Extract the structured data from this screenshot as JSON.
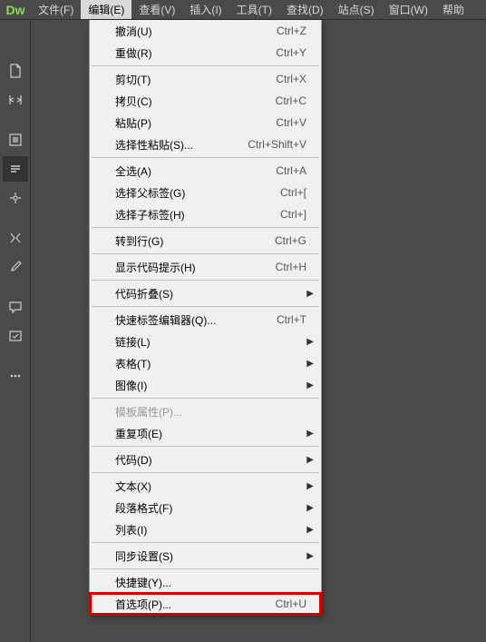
{
  "logo": "Dw",
  "menubar": [
    {
      "label": "文件(F)"
    },
    {
      "label": "编辑(E)",
      "active": true
    },
    {
      "label": "查看(V)"
    },
    {
      "label": "插入(I)"
    },
    {
      "label": "工具(T)"
    },
    {
      "label": "查找(D)"
    },
    {
      "label": "站点(S)"
    },
    {
      "label": "窗口(W)"
    },
    {
      "label": "帮助"
    }
  ],
  "dropdown": {
    "groups": [
      [
        {
          "label": "撤消(U)",
          "shortcut": "Ctrl+Z"
        },
        {
          "label": "重做(R)",
          "shortcut": "Ctrl+Y"
        }
      ],
      [
        {
          "label": "剪切(T)",
          "shortcut": "Ctrl+X"
        },
        {
          "label": "拷贝(C)",
          "shortcut": "Ctrl+C"
        },
        {
          "label": "粘贴(P)",
          "shortcut": "Ctrl+V"
        },
        {
          "label": "选择性粘贴(S)...",
          "shortcut": "Ctrl+Shift+V"
        }
      ],
      [
        {
          "label": "全选(A)",
          "shortcut": "Ctrl+A"
        },
        {
          "label": "选择父标签(G)",
          "shortcut": "Ctrl+["
        },
        {
          "label": "选择子标签(H)",
          "shortcut": "Ctrl+]"
        }
      ],
      [
        {
          "label": "转到行(G)",
          "shortcut": "Ctrl+G"
        }
      ],
      [
        {
          "label": "显示代码提示(H)",
          "shortcut": "Ctrl+H"
        }
      ],
      [
        {
          "label": "代码折叠(S)",
          "submenu": true
        }
      ],
      [
        {
          "label": "快速标签编辑器(Q)...",
          "shortcut": "Ctrl+T"
        },
        {
          "label": "链接(L)",
          "submenu": true
        },
        {
          "label": "表格(T)",
          "submenu": true
        },
        {
          "label": "图像(I)",
          "submenu": true
        }
      ],
      [
        {
          "label": "模板属性(P)...",
          "disabled": true
        },
        {
          "label": "重复项(E)",
          "submenu": true
        }
      ],
      [
        {
          "label": "代码(D)",
          "submenu": true
        }
      ],
      [
        {
          "label": "文本(X)",
          "submenu": true
        },
        {
          "label": "段落格式(F)",
          "submenu": true
        },
        {
          "label": "列表(I)",
          "submenu": true
        }
      ],
      [
        {
          "label": "同步设置(S)",
          "submenu": true
        }
      ],
      [
        {
          "label": "快捷键(Y)..."
        },
        {
          "label": "首选项(P)...",
          "shortcut": "Ctrl+U",
          "highlight": true
        }
      ]
    ]
  }
}
